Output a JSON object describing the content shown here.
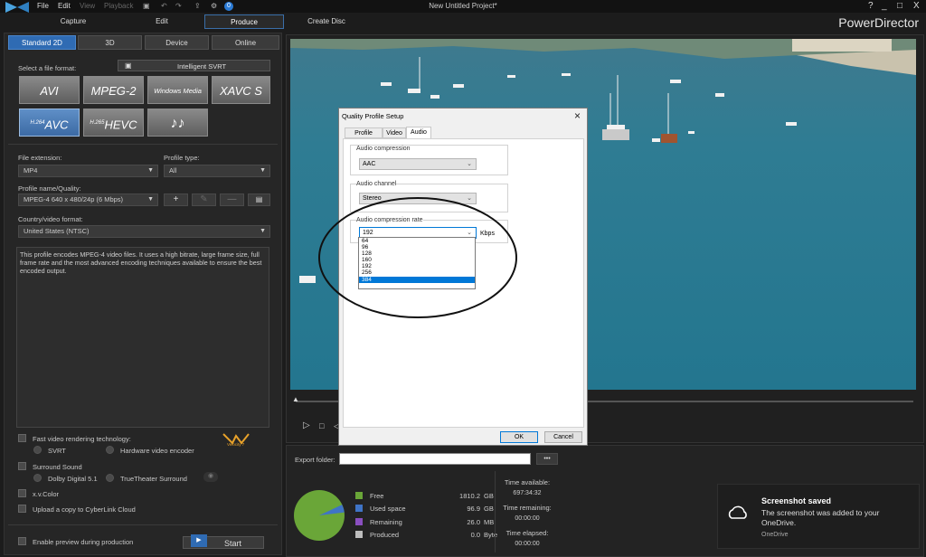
{
  "window": {
    "title": "New Untitled Project*",
    "menu": [
      "File",
      "Edit",
      "View",
      "Playback"
    ],
    "controls": [
      "?",
      "_",
      "□",
      "X"
    ]
  },
  "main_tabs": [
    "Capture",
    "Edit",
    "Produce",
    "Create Disc"
  ],
  "brand": "PowerDirector",
  "sub_tabs": [
    "Standard 2D",
    "3D",
    "Device",
    "Online"
  ],
  "format_label": "Select a file format:",
  "svrt_label": "Intelligent SVRT",
  "formats": [
    {
      "sup": "",
      "label": "AVI"
    },
    {
      "sup": "",
      "label": "MPEG-2"
    },
    {
      "sup": "",
      "label": "Windows Media"
    },
    {
      "sup": "",
      "label": "XAVC S"
    },
    {
      "sup": "H.264",
      "label": "AVC"
    },
    {
      "sup": "H.265",
      "label": "HEVC"
    },
    {
      "sup": "",
      "label": "♪♪"
    }
  ],
  "file_extension": {
    "label": "File extension:",
    "value": "MP4"
  },
  "profile_type": {
    "label": "Profile type:",
    "value": "All"
  },
  "profile_name": {
    "label": "Profile name/Quality:",
    "value": "MPEG-4 640 x 480/24p (6 Mbps)",
    "buttons": [
      "+",
      "✎",
      "—",
      "▤"
    ]
  },
  "country": {
    "label": "Country/video format:",
    "value": "United States (NTSC)"
  },
  "description": "This profile encodes MPEG-4 video files. It uses a high bitrate, large frame size, full frame rate and the most advanced encoding techniques available to ensure the best encoded output.",
  "options": {
    "fast_render": "Fast video rendering technology:",
    "svrt": "SVRT",
    "hw_encoder": "Hardware video encoder",
    "surround": "Surround Sound",
    "dolby": "Dolby Digital 5.1",
    "truetheater": "TrueTheater Surround",
    "xvcolor": "x.v.Color",
    "cloud": "Upload a copy to CyberLink Cloud",
    "preview": "Enable preview during production",
    "velocity": "Velocity 7"
  },
  "start_label": "Start",
  "export_folder": {
    "label": "Export folder:",
    "value": "",
    "browse": "•••"
  },
  "disk": {
    "legend": [
      {
        "label": "Free",
        "value": "1810.2",
        "unit": "GB",
        "color": "#6aa638"
      },
      {
        "label": "Used space",
        "value": "96.9",
        "unit": "GB",
        "color": "#3f74c6"
      },
      {
        "label": "Remaining",
        "value": "26.0",
        "unit": "MB",
        "color": "#8a4fc0"
      },
      {
        "label": "Produced",
        "value": "0.0",
        "unit": "Byte",
        "color": "#bdbdbd"
      }
    ],
    "free_fraction": 0.949
  },
  "times": [
    {
      "label": "Time available:",
      "value": "697:34:32"
    },
    {
      "label": "Time remaining:",
      "value": "00:00:00"
    },
    {
      "label": "Time elapsed:",
      "value": "00:00:00"
    }
  ],
  "toast": {
    "title": "Screenshot saved",
    "body": "The screenshot was added to your OneDrive.",
    "source": "OneDrive"
  },
  "dialog": {
    "title": "Quality Profile Setup",
    "close": "×",
    "tabs": [
      "Profile Name",
      "Video",
      "Audio"
    ],
    "audio_compression": {
      "label": "Audio compression",
      "value": "AAC"
    },
    "audio_channel": {
      "label": "Audio channel",
      "value": "Stereo"
    },
    "compression_rate": {
      "label": "Audio compression rate",
      "value": "192",
      "unit": "Kbps",
      "options": [
        "64",
        "96",
        "128",
        "160",
        "192",
        "256",
        "384"
      ],
      "highlighted": "384"
    },
    "ok": "OK",
    "cancel": "Cancel"
  }
}
